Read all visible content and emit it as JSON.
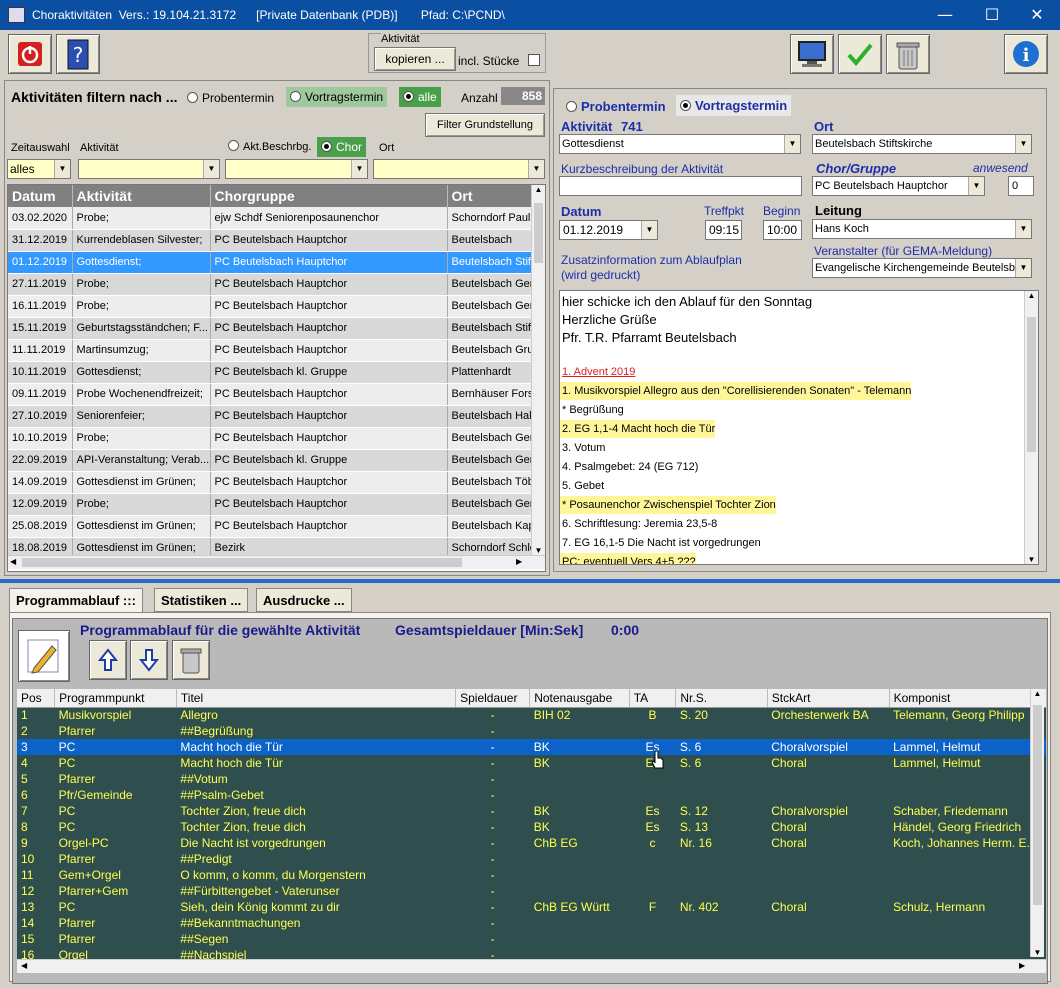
{
  "window": {
    "title": "Choraktivitäten  Vers.: 19.104.21.3172      [Private Datenbank (PDB)]       Pfad: C:\\PCND\\",
    "controls": [
      "—",
      "☐",
      "✕"
    ]
  },
  "toolbar": {
    "aktivitaet_group": "Aktivität",
    "kopieren": "kopieren ...",
    "incl_stuecke": "incl. Stücke"
  },
  "filter": {
    "heading": "Aktivitäten filtern nach ...",
    "probentermin": "Probentermin",
    "vortragstermin": "Vortragstermin",
    "alle": "alle",
    "anzahl_label": "Anzahl",
    "anzahl_value": "858",
    "grundstellung": "Filter Grundstellung",
    "zeitauswahl": "Zeitauswahl",
    "aktivitaet": "Aktivität",
    "akt_beschrbg": "Akt.Beschrbg.",
    "chor": "Chor",
    "ort": "Ort",
    "zeit_value": "alles"
  },
  "grid": {
    "headers": [
      "Datum",
      "Aktivität",
      "Chorgruppe",
      "Ort"
    ],
    "rows": [
      [
        "03.02.2020",
        "Probe;",
        "ejw Schdf Seniorenposaunenchor",
        "Schorndorf Paulu"
      ],
      [
        "31.12.2019",
        "Kurrendeblasen Silvester;",
        "PC Beutelsbach Hauptchor",
        "Beutelsbach"
      ],
      [
        "01.12.2019",
        "Gottesdienst;",
        "PC Beutelsbach Hauptchor",
        "Beutelsbach Stift"
      ],
      [
        "27.11.2019",
        "Probe;",
        "PC Beutelsbach Hauptchor",
        "Beutelsbach Gen"
      ],
      [
        "16.11.2019",
        "Probe;",
        "PC Beutelsbach Hauptchor",
        "Beutelsbach Gen"
      ],
      [
        "15.11.2019",
        "Geburtstagsständchen; F...",
        "PC Beutelsbach Hauptchor",
        "Beutelsbach Stift"
      ],
      [
        "11.11.2019",
        "Martinsumzug;",
        "PC Beutelsbach Hauptchor",
        "Beutelsbach Gru"
      ],
      [
        "10.11.2019",
        "Gottesdienst;",
        "PC Beutelsbach kl. Gruppe",
        "Plattenhardt"
      ],
      [
        "09.11.2019",
        "Probe Wochenendfreizeit;",
        "PC Beutelsbach Hauptchor",
        "Bernhäuser Forst"
      ],
      [
        "27.10.2019",
        "Seniorenfeier;",
        "PC Beutelsbach Hauptchor",
        "Beutelsbach Hall"
      ],
      [
        "10.10.2019",
        "Probe;",
        "PC Beutelsbach Hauptchor",
        "Beutelsbach Gen"
      ],
      [
        "22.09.2019",
        "API-Veranstaltung; Verab...",
        "PC Beutelsbach kl. Gruppe",
        "Beutelsbach Gen"
      ],
      [
        "14.09.2019",
        "Gottesdienst im Grünen;",
        "PC Beutelsbach Hauptchor",
        "Beutelsbach Töb"
      ],
      [
        "12.09.2019",
        "Probe;",
        "PC Beutelsbach Hauptchor",
        "Beutelsbach Gen"
      ],
      [
        "25.08.2019",
        "Gottesdienst im Grünen;",
        "PC Beutelsbach Hauptchor",
        "Beutelsbach Kap"
      ],
      [
        "18.08.2019",
        "Gottesdienst im Grünen;",
        "Bezirk",
        "Schorndorf Schlo"
      ]
    ],
    "selected_index": 2
  },
  "detail": {
    "probentermin": "Probentermin",
    "vortragstermin": "Vortragstermin",
    "aktivitaet_label": "Aktivität",
    "aktivitaet_nr": "741",
    "aktivitaet_value": "Gottesdienst",
    "ort_label": "Ort",
    "ort_value": "Beutelsbach Stiftskirche",
    "kurzbeschreibung_label": "Kurzbeschreibung der Aktivität",
    "kurzbeschreibung_value": "",
    "chor_label": "Chor/Gruppe",
    "chor_value": "PC Beutelsbach Hauptchor",
    "anwesend_label": "anwesend",
    "anwesend_value": "0",
    "datum_label": "Datum",
    "datum_value": "01.12.2019",
    "treffpkt_label": "Treffpkt",
    "treffpkt_value": "09:15",
    "beginn_label": "Beginn",
    "beginn_value": "10:00",
    "leitung_label": "Leitung",
    "leitung_value": "Hans Koch",
    "zusatz_label_1": "Zusatzinformation zum Ablaufplan",
    "zusatz_label_2": "(wird gedruckt)",
    "veranstalter_label": "Veranstalter (für GEMA-Meldung)",
    "veranstalter_value": "Evangelische Kirchengemeinde Beutelsbach",
    "notes_intro": [
      "hier schicke ich den Ablauf für den Sonntag",
      "Herzliche Grüße",
      "Pfr. T.R. Pfarramt Beutelsbach"
    ],
    "notes_lines": [
      {
        "text": "1. Advent 2019",
        "style": "red"
      },
      {
        "text": "1. Musikvorspiel  Allegro aus den \"Corellisierenden Sonaten\" - Telemann",
        "style": "hl"
      },
      {
        "text": "* Begrüßung",
        "style": ""
      },
      {
        "text": "2. EG 1,1-4 Macht hoch die Tür",
        "style": "hl"
      },
      {
        "text": "3. Votum",
        "style": ""
      },
      {
        "text": "4. Psalmgebet: 24 (EG 712)",
        "style": ""
      },
      {
        "text": "5. Gebet",
        "style": ""
      },
      {
        "text": "* Posaunenchor Zwischenspiel  Tochter Zion",
        "style": "hl"
      },
      {
        "text": "6. Schriftlesung: Jeremia 23,5-8",
        "style": ""
      },
      {
        "text": "7. EG 16,1-5 Die Nacht ist vorgedrungen",
        "style": ""
      },
      {
        "text": "PC: eventuell Vers 4+5 ???",
        "style": "hl"
      }
    ]
  },
  "tabs": [
    "Programmablauf :::",
    "Statistiken ...",
    "Ausdrucke ..."
  ],
  "program": {
    "title": "Programmablauf für die gewählte Aktivität",
    "dauer_label": "Gesamtspieldauer [Min:Sek]",
    "dauer_value": "0:00",
    "headers": [
      "Pos",
      "Programmpunkt",
      "Titel",
      "Spieldauer",
      "Notenausgabe",
      "TA",
      "Nr.S.",
      "StckArt",
      "Komponist"
    ],
    "rows": [
      [
        "1",
        "Musikvorspiel",
        "Allegro",
        "-",
        "BIH 02",
        "B",
        "S. 20",
        "Orchesterwerk BA",
        "Telemann, Georg Philipp"
      ],
      [
        "2",
        "Pfarrer",
        "##Begrüßung",
        "-",
        "",
        "",
        "",
        "",
        ""
      ],
      [
        "3",
        "PC",
        "Macht hoch die Tür",
        "-",
        "BK",
        "Es",
        "S. 6",
        "Choralvorspiel",
        "Lammel, Helmut"
      ],
      [
        "4",
        "PC",
        "Macht hoch die Tür",
        "-",
        "BK",
        "Es",
        "S. 6",
        "Choral",
        "Lammel, Helmut"
      ],
      [
        "5",
        "Pfarrer",
        "##Votum",
        "-",
        "",
        "",
        "",
        "",
        ""
      ],
      [
        "6",
        "Pfr/Gemeinde",
        "##Psalm-Gebet",
        "-",
        "",
        "",
        "",
        "",
        ""
      ],
      [
        "7",
        "PC",
        "Tochter Zion, freue dich",
        "-",
        "BK",
        "Es",
        "S. 12",
        "Choralvorspiel",
        "Schaber, Friedemann"
      ],
      [
        "8",
        "PC",
        "Tochter Zion, freue dich",
        "-",
        "BK",
        "Es",
        "S. 13",
        "Choral",
        "Händel, Georg Friedrich"
      ],
      [
        "9",
        "Orgel-PC",
        "Die Nacht ist vorgedrungen",
        "-",
        "ChB EG",
        "c",
        "Nr. 16",
        "Choral",
        "Koch, Johannes Herm. E..."
      ],
      [
        "10",
        "Pfarrer",
        "##Predigt",
        "-",
        "",
        "",
        "",
        "",
        ""
      ],
      [
        "11",
        "Gem+Orgel",
        "O komm, o komm, du Morgenstern",
        "-",
        "",
        "",
        "",
        "",
        ""
      ],
      [
        "12",
        "Pfarrer+Gem",
        "##Fürbittengebet - Vaterunser",
        "-",
        "",
        "",
        "",
        "",
        ""
      ],
      [
        "13",
        "PC",
        "Sieh, dein König kommt zu dir",
        "-",
        "ChB EG Württ",
        "F",
        "Nr. 402",
        "Choral",
        "Schulz, Hermann"
      ],
      [
        "14",
        "Pfarrer",
        "##Bekanntmachungen",
        "-",
        "",
        "",
        "",
        "",
        ""
      ],
      [
        "15",
        "Pfarrer",
        "##Segen",
        "-",
        "",
        "",
        "",
        "",
        ""
      ],
      [
        "16",
        "Orgel",
        "##Nachspiel",
        "-",
        "",
        "",
        "",
        "",
        ""
      ]
    ],
    "selected_index": 2
  }
}
